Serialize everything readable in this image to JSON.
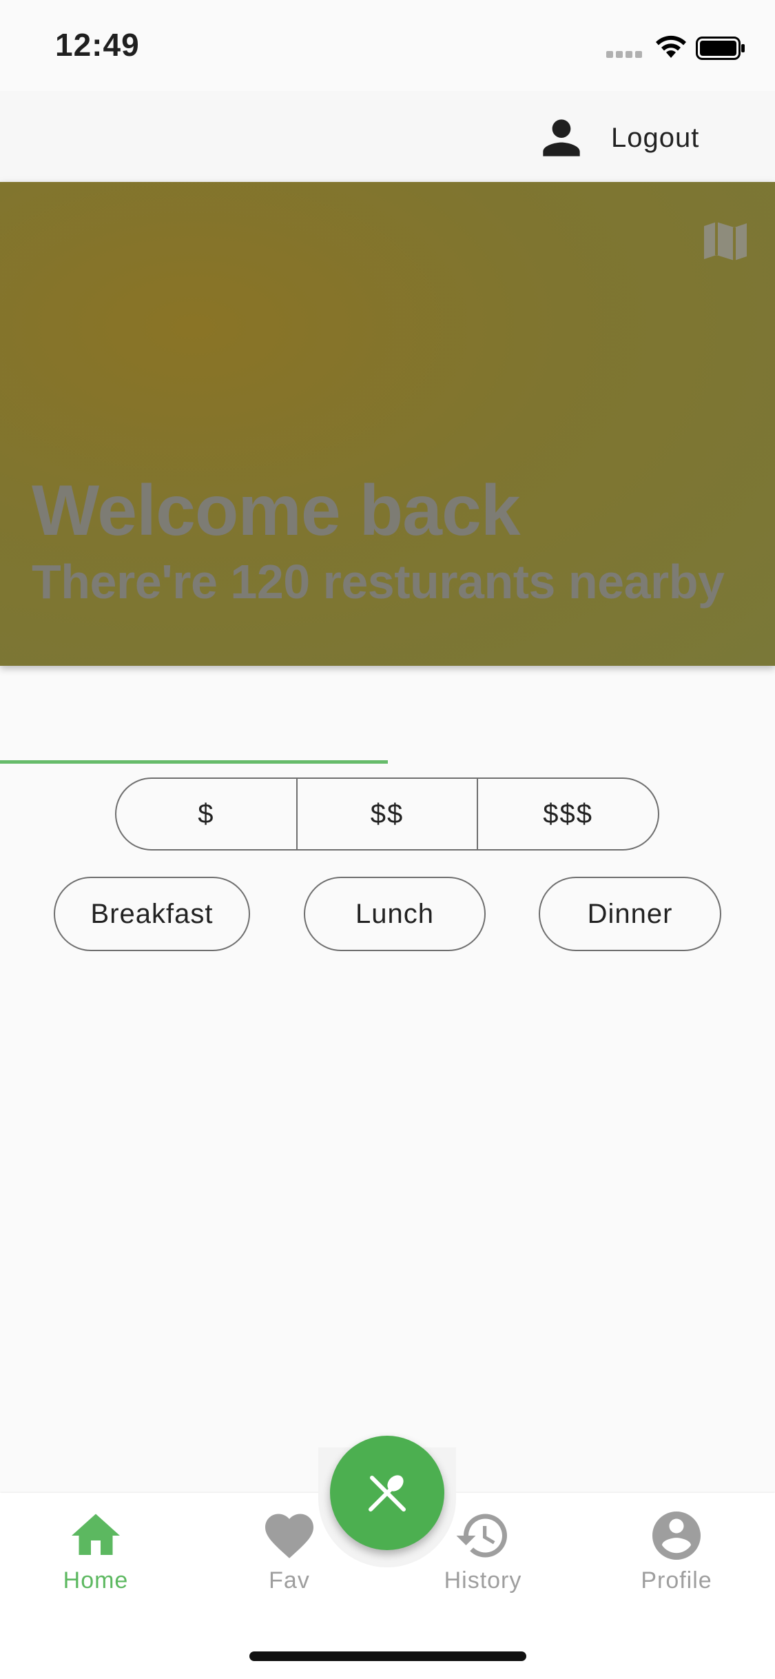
{
  "status_bar": {
    "time": "12:49"
  },
  "header": {
    "logout_label": "Logout",
    "icon": "person-icon"
  },
  "hero": {
    "title": "Welcome back",
    "subtitle": "There're 120 resturants nearby",
    "map_icon": "map-icon",
    "background_color": "#807530"
  },
  "progress": {
    "value_fraction": 0.5,
    "color": "#66bb6a"
  },
  "price_filter": {
    "options": [
      "$",
      "$$",
      "$$$"
    ]
  },
  "meal_filter": {
    "options": [
      "Breakfast",
      "Lunch",
      "Dinner"
    ]
  },
  "bottom_nav": {
    "items": [
      {
        "label": "Home",
        "icon": "home-icon",
        "active": true
      },
      {
        "label": "Fav",
        "icon": "heart-icon",
        "active": false
      },
      {
        "label": "History",
        "icon": "history-icon",
        "active": false
      },
      {
        "label": "Profile",
        "icon": "account-circle-icon",
        "active": false
      }
    ],
    "fab_icon": "restaurant-icon",
    "active_color": "#5cb860",
    "inactive_color": "#9e9e9e",
    "fab_color": "#4caf50"
  }
}
